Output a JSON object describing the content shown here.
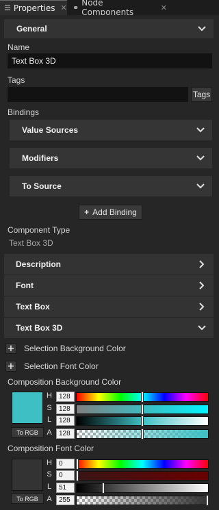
{
  "tabs": [
    {
      "label": "Properties",
      "icon": "list-icon",
      "active": true
    },
    {
      "label": "Node Components",
      "icon": "components-icon",
      "active": false
    }
  ],
  "general": {
    "title": "General"
  },
  "name": {
    "label": "Name",
    "value": "Text Box 3D"
  },
  "tags": {
    "label": "Tags",
    "value": "",
    "button": "Tags"
  },
  "bindings": {
    "label": "Bindings",
    "sections": [
      "Value Sources",
      "Modifiers",
      "To Source"
    ],
    "add_button": "Add Binding"
  },
  "component_type": {
    "label": "Component Type",
    "value": "Text Box 3D"
  },
  "categories": [
    {
      "title": "Description",
      "expanded": false
    },
    {
      "title": "Font",
      "expanded": false
    },
    {
      "title": "Text Box",
      "expanded": false
    },
    {
      "title": "Text Box 3D",
      "expanded": true
    }
  ],
  "add_properties": [
    "Selection Background Color",
    "Selection Font Color"
  ],
  "composition_bg": {
    "label": "Composition Background Color",
    "swatch": "#3dbfc4",
    "to_rgb": "To RGB",
    "channels": [
      {
        "name": "H",
        "value": "128",
        "level": 0.5
      },
      {
        "name": "S",
        "value": "128",
        "level": 0.5
      },
      {
        "name": "L",
        "value": "128",
        "level": 0.5
      },
      {
        "name": "A",
        "value": "128",
        "level": 0.5
      }
    ]
  },
  "composition_font": {
    "label": "Composition Font Color",
    "swatch": "#333333",
    "to_rgb": "To RGB",
    "channels": [
      {
        "name": "H",
        "value": "0",
        "level": 0
      },
      {
        "name": "S",
        "value": "0",
        "level": 0
      },
      {
        "name": "L",
        "value": "51",
        "level": 0.2
      },
      {
        "name": "A",
        "value": "255",
        "level": 1
      }
    ]
  }
}
